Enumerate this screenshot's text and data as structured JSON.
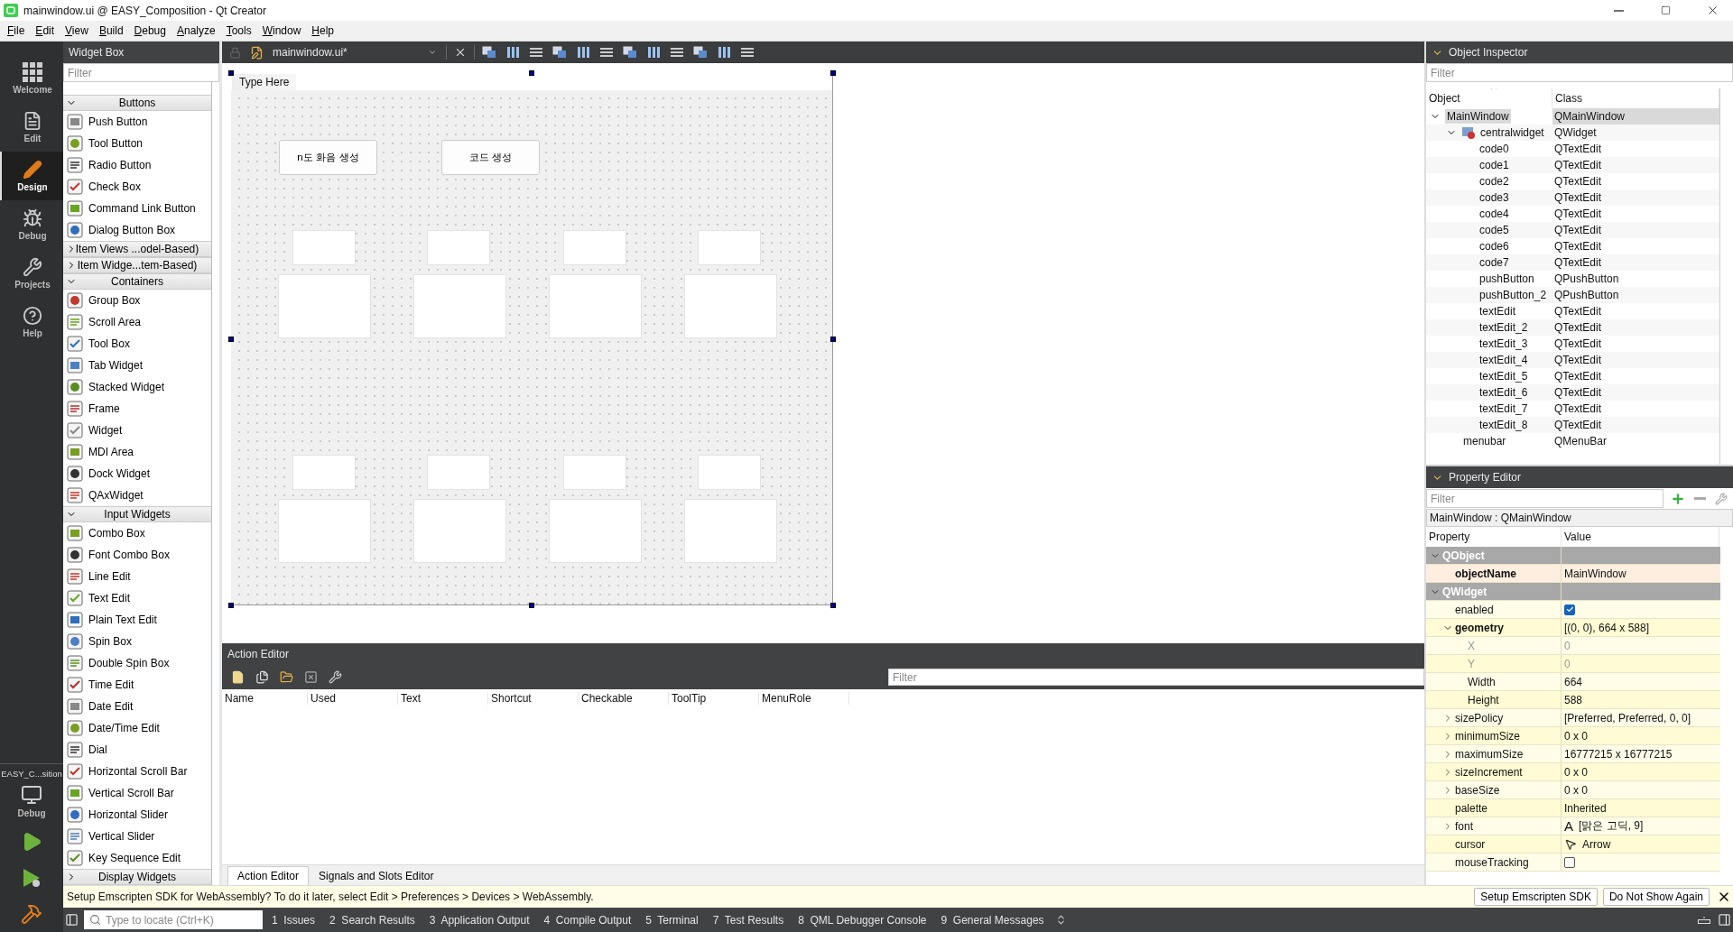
{
  "window": {
    "title": "mainwindow.ui @ EASY_Composition - Qt Creator"
  },
  "menu_bar": [
    "File",
    "Edit",
    "View",
    "Build",
    "Debug",
    "Analyze",
    "Tools",
    "Window",
    "Help"
  ],
  "mode_bar": {
    "modes": [
      {
        "label": "Welcome",
        "selected": false
      },
      {
        "label": "Edit",
        "selected": false
      },
      {
        "label": "Design",
        "selected": true
      },
      {
        "label": "Debug",
        "selected": false
      },
      {
        "label": "Projects",
        "selected": false
      },
      {
        "label": "Help",
        "selected": false
      }
    ],
    "kit": {
      "project": "EASY_C...sition",
      "build": "Debug"
    }
  },
  "widget_box": {
    "title": "Widget Box",
    "filter": {
      "placeholder": "Filter"
    },
    "sections": [
      {
        "label": "Buttons",
        "expanded": true,
        "items": [
          "Push Button",
          "Tool Button",
          "Radio Button",
          "Check Box",
          "Command Link Button",
          "Dialog Button Box"
        ]
      },
      {
        "label": "Item Views ...odel-Based)",
        "expanded": false
      },
      {
        "label": "Item Widge...tem-Based)",
        "expanded": false
      },
      {
        "label": "Containers",
        "expanded": true,
        "items": [
          "Group Box",
          "Scroll Area",
          "Tool Box",
          "Tab Widget",
          "Stacked Widget",
          "Frame",
          "Widget",
          "MDI Area",
          "Dock Widget",
          "QAxWidget"
        ]
      },
      {
        "label": "Input Widgets",
        "expanded": true,
        "items": [
          "Combo Box",
          "Font Combo Box",
          "Line Edit",
          "Text Edit",
          "Plain Text Edit",
          "Spin Box",
          "Double Spin Box",
          "Time Edit",
          "Date Edit",
          "Date/Time Edit",
          "Dial",
          "Horizontal Scroll Bar",
          "Vertical Scroll Bar",
          "Horizontal Slider",
          "Vertical Slider",
          "Key Sequence Edit"
        ]
      },
      {
        "label": "Display Widgets",
        "expanded": false
      }
    ]
  },
  "editor": {
    "file": "mainwindow.ui*"
  },
  "form": {
    "menu_placeholder": "Type Here",
    "buttons": [
      "n도 화음 생성",
      "코드 생성"
    ]
  },
  "action_editor": {
    "title": "Action Editor",
    "filter": {
      "placeholder": "Filter"
    },
    "columns": [
      "Name",
      "Used",
      "Text",
      "Shortcut",
      "Checkable",
      "ToolTip",
      "MenuRole"
    ]
  },
  "bottom_tabs": [
    {
      "label": "Action Editor",
      "selected": true
    },
    {
      "label": "Signals and Slots Editor",
      "selected": false
    }
  ],
  "object_inspector": {
    "title": "Object Inspector",
    "filter": {
      "placeholder": "Filter"
    },
    "columns": [
      "Object",
      "Class"
    ],
    "tree": [
      {
        "object": "MainWindow",
        "class": "QMainWindow",
        "selected": true,
        "expanded": true,
        "children": [
          {
            "object": "centralwidget",
            "class": "QWidget",
            "selected": false,
            "expanded": true,
            "children": [
              {
                "object": "code0",
                "class": "QTextEdit",
                "selected": false
              },
              {
                "object": "code1",
                "class": "QTextEdit",
                "selected": false
              },
              {
                "object": "code2",
                "class": "QTextEdit",
                "selected": false
              },
              {
                "object": "code3",
                "class": "QTextEdit",
                "selected": false
              },
              {
                "object": "code4",
                "class": "QTextEdit",
                "selected": false
              },
              {
                "object": "code5",
                "class": "QTextEdit",
                "selected": false
              },
              {
                "object": "code6",
                "class": "QTextEdit",
                "selected": false
              },
              {
                "object": "code7",
                "class": "QTextEdit",
                "selected": false
              },
              {
                "object": "pushButton",
                "class": "QPushButton",
                "selected": false
              },
              {
                "object": "pushButton_2",
                "class": "QPushButton",
                "selected": false
              },
              {
                "object": "textEdit",
                "class": "QTextEdit",
                "selected": false
              },
              {
                "object": "textEdit_2",
                "class": "QTextEdit",
                "selected": false
              },
              {
                "object": "textEdit_3",
                "class": "QTextEdit",
                "selected": false
              },
              {
                "object": "textEdit_4",
                "class": "QTextEdit",
                "selected": false
              },
              {
                "object": "textEdit_5",
                "class": "QTextEdit",
                "selected": false
              },
              {
                "object": "textEdit_6",
                "class": "QTextEdit",
                "selected": false
              },
              {
                "object": "textEdit_7",
                "class": "QTextEdit",
                "selected": false
              },
              {
                "object": "textEdit_8",
                "class": "QTextEdit",
                "selected": false
              }
            ]
          },
          {
            "object": "menubar",
            "class": "QMenuBar",
            "selected": false
          }
        ]
      }
    ]
  },
  "property_editor": {
    "title": "Property Editor",
    "filter": {
      "placeholder": "Filter"
    },
    "object_label": "MainWindow : QMainWindow",
    "columns": [
      "Property",
      "Value"
    ],
    "rows": [
      {
        "kind": "group",
        "name": "QObject",
        "expanded": true,
        "children": [
          {
            "kind": "text",
            "name": "objectName",
            "value": "MainWindow",
            "changed": true
          }
        ]
      },
      {
        "kind": "group",
        "name": "QWidget",
        "expanded": true,
        "children": [
          {
            "kind": "checkbox",
            "name": "enabled",
            "checked": true,
            "changed": false
          },
          {
            "kind": "text",
            "name": "geometry",
            "value": "[(0, 0), 664 x 588]",
            "changed": true,
            "expanded": true,
            "children": [
              {
                "kind": "text",
                "name": "X",
                "value": "0",
                "disabled": true
              },
              {
                "kind": "text",
                "name": "Y",
                "value": "0",
                "disabled": true
              },
              {
                "kind": "text",
                "name": "Width",
                "value": "664",
                "disabled": false
              },
              {
                "kind": "text",
                "name": "Height",
                "value": "588",
                "disabled": false
              }
            ]
          },
          {
            "kind": "text",
            "name": "sizePolicy",
            "value": "[Preferred, Preferred, 0, 0]",
            "changed": false,
            "expanded": false
          },
          {
            "kind": "text",
            "name": "minimumSize",
            "value": "0 x 0",
            "changed": false,
            "expanded": false
          },
          {
            "kind": "text",
            "name": "maximumSize",
            "value": "16777215 x 16777215",
            "changed": false,
            "expanded": false
          },
          {
            "kind": "text",
            "name": "sizeIncrement",
            "value": "0 x 0",
            "changed": false,
            "expanded": false
          },
          {
            "kind": "text",
            "name": "baseSize",
            "value": "0 x 0",
            "changed": false,
            "expanded": false
          },
          {
            "kind": "text",
            "name": "palette",
            "value": "Inherited",
            "changed": false
          },
          {
            "kind": "font",
            "name": "font",
            "glyph": "A",
            "value": "[맑은 고딕, 9]",
            "changed": false,
            "expanded": false
          },
          {
            "kind": "cursor",
            "name": "cursor",
            "value": "Arrow",
            "changed": false
          },
          {
            "kind": "checkbox",
            "name": "mouseTracking",
            "checked": false,
            "changed": false
          }
        ]
      }
    ]
  },
  "info_bar": {
    "message": "Setup Emscripten SDK for WebAssembly? To do it later, select Edit > Preferences > Devices > WebAssembly.",
    "buttons": [
      "Setup Emscripten SDK",
      "Do Not Show Again"
    ]
  },
  "status_bar": {
    "locator": {
      "placeholder": "Type to locate (Ctrl+K)"
    },
    "panes": [
      "1  Issues",
      "2  Search Results",
      "3  Application Output",
      "4  Compile Output",
      "5  Terminal",
      "7  Test Results",
      "8  QML Debugger Console",
      "9  General Messages"
    ]
  }
}
